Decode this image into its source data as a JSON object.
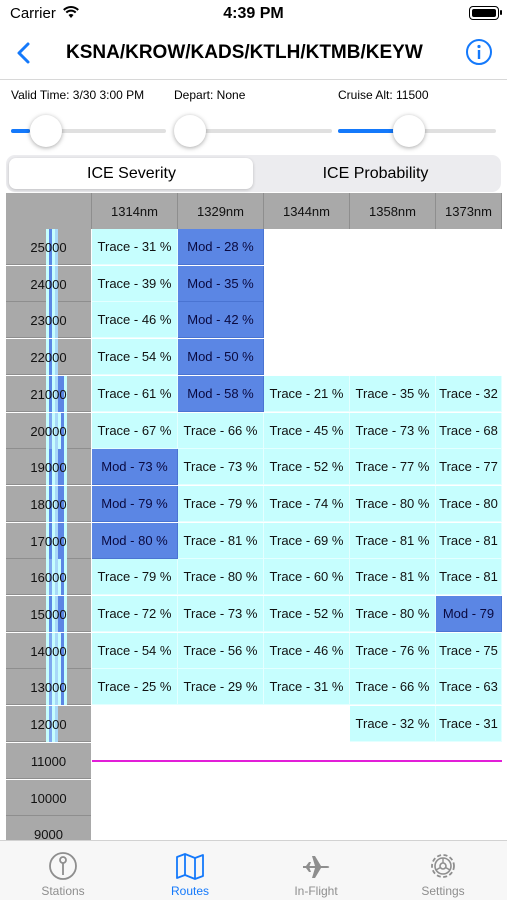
{
  "status_bar": {
    "carrier": "Carrier",
    "time": "4:39 PM"
  },
  "nav": {
    "title": "KSNA/KROW/KADS/KTLH/KTMB/KEYW",
    "back_icon": "chevron-left-icon",
    "info_icon": "info-circle-icon"
  },
  "controls": {
    "valid_time": "Valid Time: 3/30 3:00 PM",
    "depart": "Depart: None",
    "cruise_alt": "Cruise Alt: 11500",
    "valid_time_level": 0.12,
    "depart_level": 0.0,
    "cruise_alt_level": 0.45
  },
  "segmented": {
    "options": [
      "ICE Severity",
      "ICE Probability"
    ],
    "selected": "ICE Severity"
  },
  "colors": {
    "accent": "#1479fb",
    "trace": "#c6fefe",
    "moderate": "#5b86e4",
    "header": "#a9a9a9",
    "cruise_line": "#e21ed8"
  },
  "grid": {
    "columns": [
      "1314nm",
      "1329nm",
      "1344nm",
      "1358nm",
      "1373nm"
    ],
    "rows": [
      {
        "alt": "25000",
        "cells": [
          "Trace - 31 %",
          "Mod - 28 %",
          "",
          "",
          ""
        ]
      },
      {
        "alt": "24000",
        "cells": [
          "Trace - 39 %",
          "Mod - 35 %",
          "",
          "",
          ""
        ]
      },
      {
        "alt": "23000",
        "cells": [
          "Trace - 46 %",
          "Mod - 42 %",
          "",
          "",
          ""
        ]
      },
      {
        "alt": "22000",
        "cells": [
          "Trace - 54 %",
          "Mod - 50 %",
          "",
          "",
          ""
        ]
      },
      {
        "alt": "21000",
        "cells": [
          "Trace - 61 %",
          "Mod - 58 %",
          "Trace - 21 %",
          "Trace - 35 %",
          "Trace - 32"
        ]
      },
      {
        "alt": "20000",
        "cells": [
          "Trace - 67 %",
          "Trace - 66 %",
          "Trace - 45 %",
          "Trace - 73 %",
          "Trace - 68"
        ]
      },
      {
        "alt": "19000",
        "cells": [
          "Mod - 73 %",
          "Trace - 73 %",
          "Trace - 52 %",
          "Trace - 77 %",
          "Trace - 77"
        ]
      },
      {
        "alt": "18000",
        "cells": [
          "Mod - 79 %",
          "Trace - 79 %",
          "Trace - 74 %",
          "Trace - 80 %",
          "Trace - 80"
        ]
      },
      {
        "alt": "17000",
        "cells": [
          "Mod - 80 %",
          "Trace - 81 %",
          "Trace - 69 %",
          "Trace - 81 %",
          "Trace - 81"
        ]
      },
      {
        "alt": "16000",
        "cells": [
          "Trace - 79 %",
          "Trace - 80 %",
          "Trace - 60 %",
          "Trace - 81 %",
          "Trace - 81"
        ]
      },
      {
        "alt": "15000",
        "cells": [
          "Trace - 72 %",
          "Trace - 73 %",
          "Trace - 52 %",
          "Trace - 80 %",
          "Mod - 79"
        ]
      },
      {
        "alt": "14000",
        "cells": [
          "Trace - 54 %",
          "Trace - 56 %",
          "Trace - 46 %",
          "Trace - 76 %",
          "Trace - 75"
        ]
      },
      {
        "alt": "13000",
        "cells": [
          "Trace - 25 %",
          "Trace - 29 %",
          "Trace - 31 %",
          "Trace - 66 %",
          "Trace - 63"
        ]
      },
      {
        "alt": "12000",
        "cells": [
          "",
          "",
          "",
          "Trace - 32 %",
          "Trace - 31"
        ]
      },
      {
        "alt": "11000",
        "cells": [
          "",
          "",
          "",
          "",
          ""
        ]
      },
      {
        "alt": "10000",
        "cells": [
          "",
          "",
          "",
          "",
          ""
        ]
      },
      {
        "alt": "9000",
        "cells": [
          "",
          "",
          "",
          "",
          ""
        ]
      }
    ],
    "cruise_line_after_alt": "11000"
  },
  "tabs": [
    {
      "label": "Stations",
      "icon": "pin-circle-icon",
      "active": false
    },
    {
      "label": "Routes",
      "icon": "map-icon",
      "active": true
    },
    {
      "label": "In-Flight",
      "icon": "airplane-icon",
      "active": false
    },
    {
      "label": "Settings",
      "icon": "gear-icon",
      "active": false
    }
  ]
}
